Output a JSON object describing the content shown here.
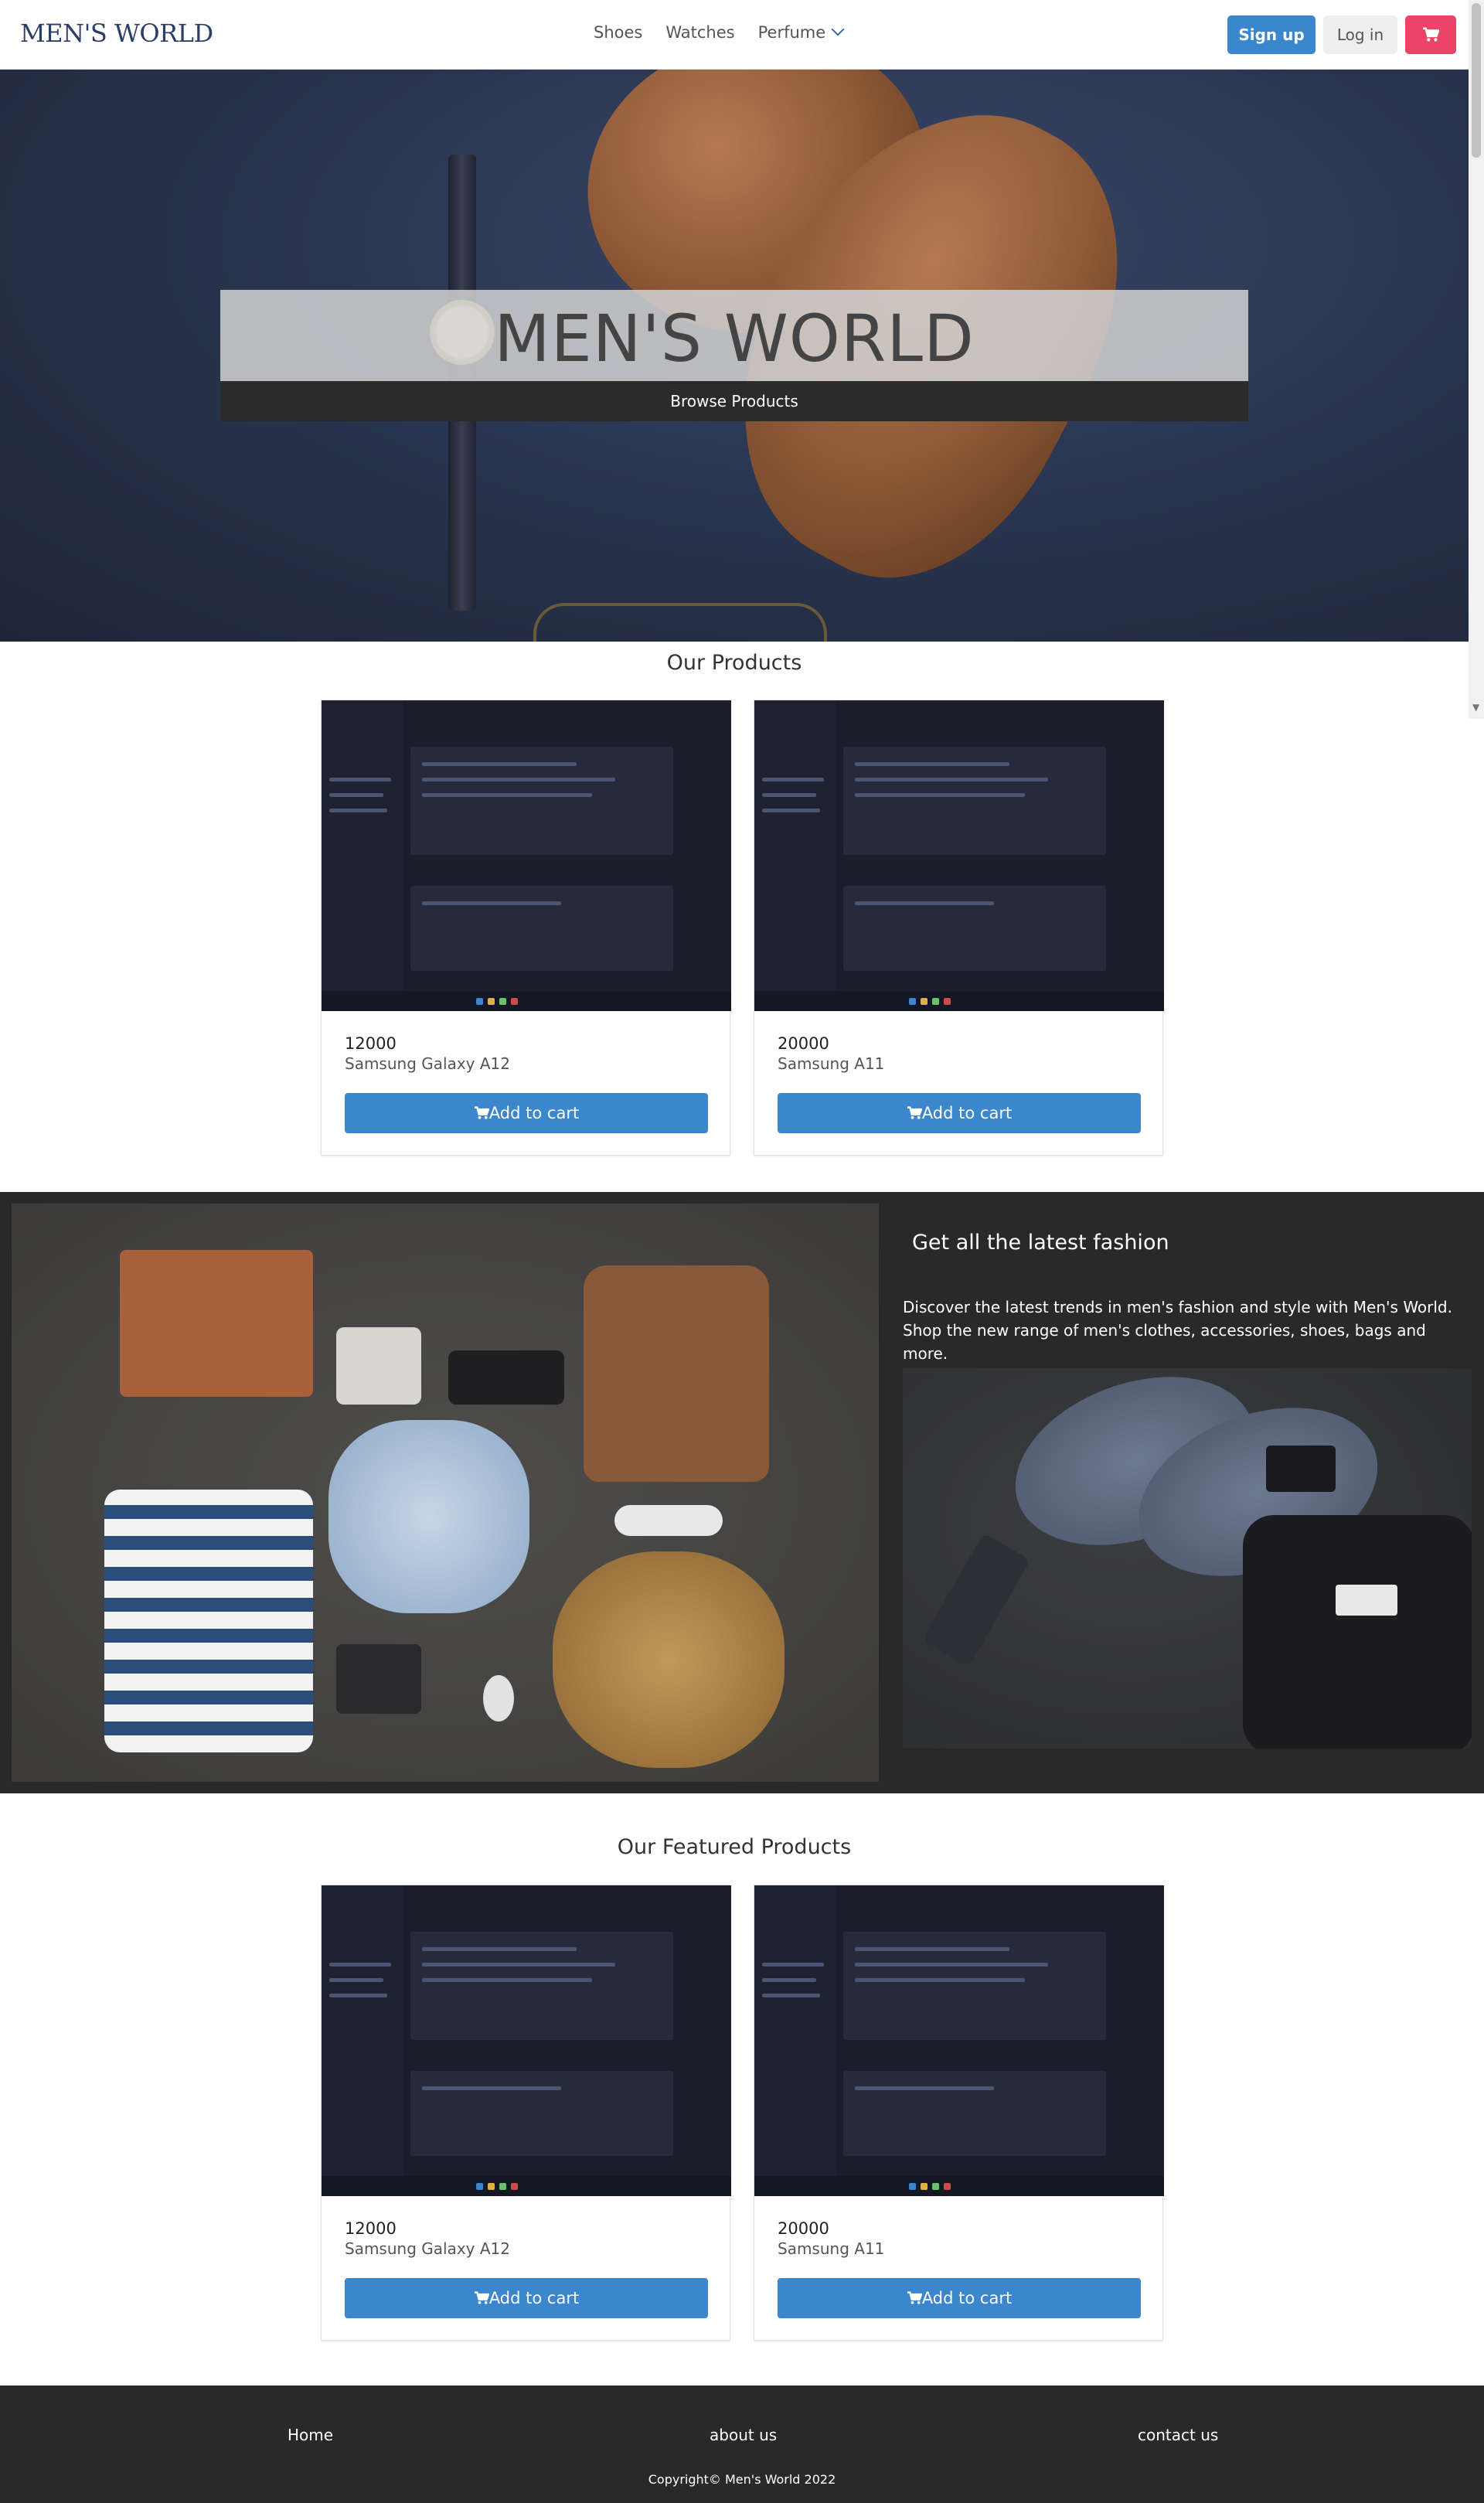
{
  "brand": {
    "logo_text": "MEN'S WORLD"
  },
  "nav": {
    "links": [
      "Shoes",
      "Watches",
      "Perfume"
    ],
    "signup_label": "Sign up",
    "login_label": "Log in"
  },
  "hero": {
    "title": "MEN'S WORLD",
    "browse_label": "Browse Products"
  },
  "products": {
    "title": "Our Products",
    "items": [
      {
        "price": "12000",
        "name": "Samsung Galaxy A12",
        "button": "Add to cart"
      },
      {
        "price": "20000",
        "name": "Samsung A11",
        "button": "Add to cart"
      }
    ]
  },
  "fashion": {
    "heading": "Get all the latest fashion",
    "text": "Discover the latest trends in men's fashion and style with Men's World. Shop the new range of men's clothes, accessories, shoes, bags and more."
  },
  "featured": {
    "title": "Our Featured Products",
    "items": [
      {
        "price": "12000",
        "name": "Samsung Galaxy A12",
        "button": "Add to cart"
      },
      {
        "price": "20000",
        "name": "Samsung A11",
        "button": "Add to cart"
      }
    ]
  },
  "footer": {
    "links": [
      "Home",
      "about us",
      "contact us"
    ],
    "copyright": "Copyright© Men's World 2022"
  },
  "colors": {
    "primary": "#3b86cc",
    "cart": "#ec4466",
    "dark": "#2a2929"
  },
  "icons": [
    "cart-icon",
    "chevron-down-icon"
  ]
}
